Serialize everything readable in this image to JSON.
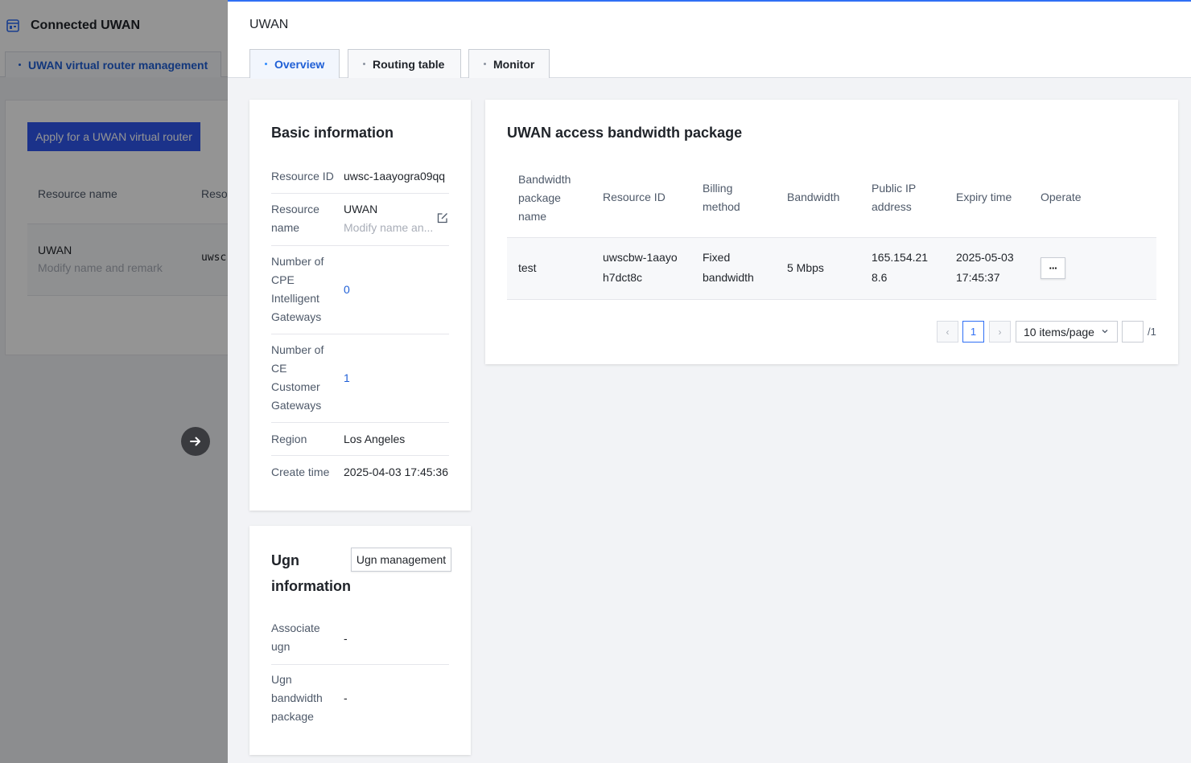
{
  "background": {
    "app_title": "Connected UWAN",
    "tab_label": "UWAN virtual router management",
    "apply_button": "Apply for a UWAN virtual router",
    "columns": [
      "Resource name",
      "Resou"
    ],
    "row": {
      "name": "UWAN",
      "remark": "Modify name and remark",
      "resource_id": "uwsc-"
    }
  },
  "drawer": {
    "title": "UWAN",
    "tabs": [
      {
        "label": "Overview",
        "active": true
      },
      {
        "label": "Routing table",
        "active": false
      },
      {
        "label": "Monitor",
        "active": false
      }
    ]
  },
  "basic_info": {
    "title": "Basic information",
    "rows": [
      {
        "label": "Resource ID",
        "value": "uwsc-1aayogra09qq"
      },
      {
        "label": "Resource name",
        "value": "UWAN",
        "sub": "Modify name an..."
      },
      {
        "label": "Number of CPE Intelligent Gateways",
        "value": "0"
      },
      {
        "label": "Number of CE Customer Gateways",
        "value": "1"
      },
      {
        "label": "Region",
        "value": "Los Angeles"
      },
      {
        "label": "Create time",
        "value": "2025-04-03 17:45:36"
      }
    ]
  },
  "ugn_info": {
    "title": "Ugn information",
    "button": "Ugn management",
    "rows": [
      {
        "label": "Associate ugn",
        "value": "-"
      },
      {
        "label": "Ugn bandwidth package",
        "value": "-"
      }
    ]
  },
  "bandwidth": {
    "title": "UWAN access bandwidth package",
    "columns": [
      "Bandwidth package name",
      "Resource ID",
      "Billing method",
      "Bandwidth",
      "Public IP address",
      "Expiry time",
      "Operate"
    ],
    "rows": [
      {
        "name": "test",
        "resource_id": "uwscbw-1aayoh7dct8c",
        "billing": "Fixed bandwidth",
        "bandwidth": "5 Mbps",
        "ip": "165.154.218.6",
        "expiry": "2025-05-03 17:45:37",
        "operate": "···"
      }
    ],
    "pagination": {
      "prev": "‹",
      "current_page": "1",
      "next": "›",
      "page_size": "10 items/page",
      "total": "/1"
    }
  },
  "colors": {
    "primary": "#2f6ff5",
    "link": "#1f5fd6",
    "apply_button_bg": "#2f57ee"
  }
}
